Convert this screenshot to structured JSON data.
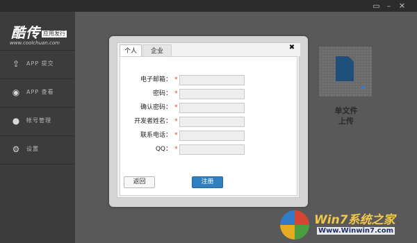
{
  "titlebar": {
    "icons": [
      "chat-icon",
      "minimize-icon",
      "close-icon"
    ],
    "background": "#2c2c2c"
  },
  "logo": {
    "main": "酷传",
    "tag": "应用发行",
    "url": "www.coolchuan.com"
  },
  "sidebar": {
    "items": [
      {
        "icon": "upload-icon",
        "label": "APP 提交"
      },
      {
        "icon": "eye-icon",
        "label": "APP 查看"
      },
      {
        "icon": "user-icon",
        "label": "帐号管理"
      },
      {
        "icon": "gear-icon",
        "label": "设置"
      }
    ]
  },
  "upload": {
    "label_line1": "单文件",
    "label_line2": "上传"
  },
  "modal": {
    "tabs": [
      "个人",
      "企业"
    ],
    "active_tab": "个人",
    "fields": [
      {
        "label": "电子邮箱：",
        "required": "*",
        "value": ""
      },
      {
        "label": "密码：",
        "required": "*",
        "value": ""
      },
      {
        "label": "确认密码：",
        "required": "*",
        "value": ""
      },
      {
        "label": "开发者姓名：",
        "required": "*",
        "value": ""
      },
      {
        "label": "联系电话：",
        "required": "*",
        "value": ""
      },
      {
        "label": "QQ：",
        "required": "*",
        "value": ""
      }
    ],
    "back_label": "返回",
    "register_label": "注册"
  },
  "watermark": {
    "title": "Win7系统之家",
    "url": "Www.Winwin7.com"
  },
  "colors": {
    "accent": "#2f7fc1",
    "required": "#d23a2f",
    "sidebar": "#3c3c3c"
  }
}
